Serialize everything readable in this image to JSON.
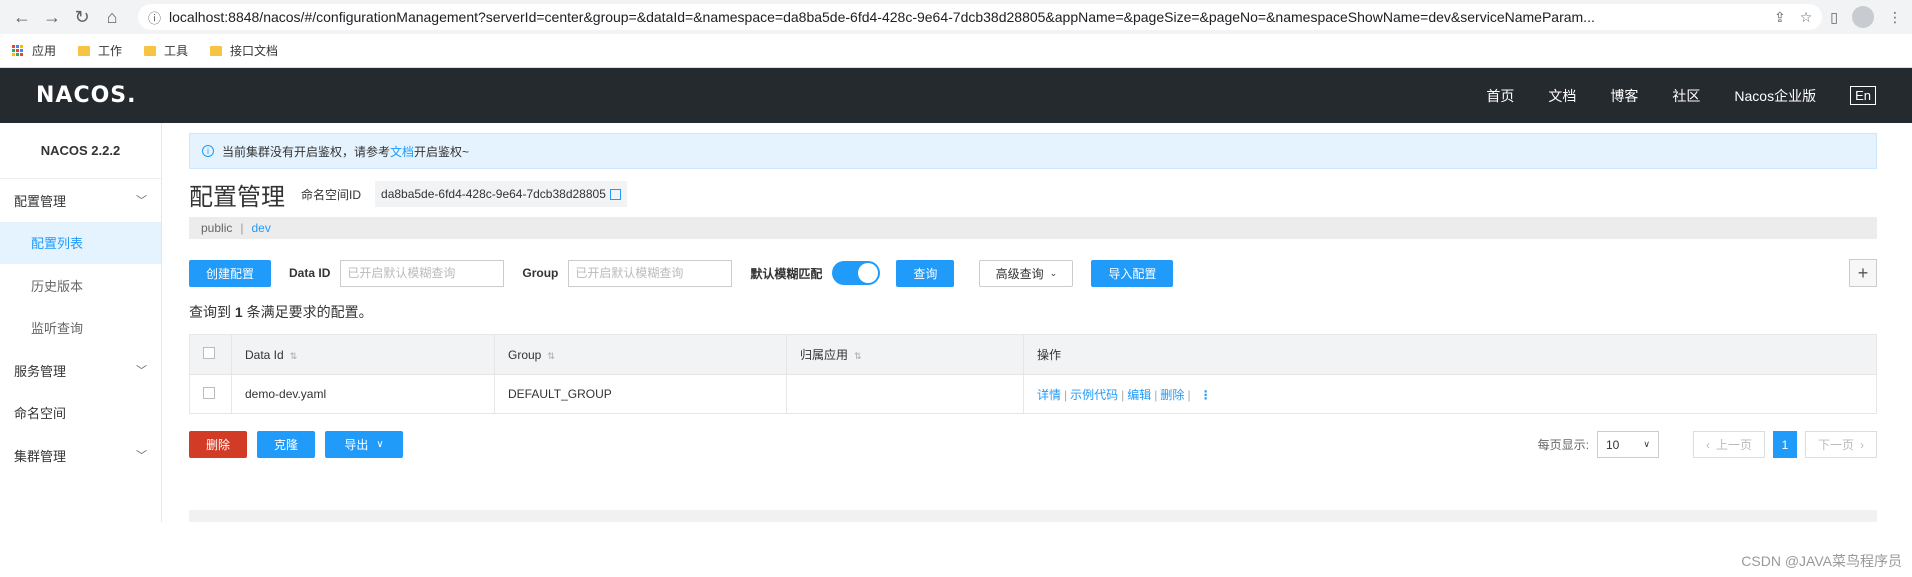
{
  "browser": {
    "url": "localhost:8848/nacos/#/configurationManagement?serverId=center&group=&dataId=&namespace=da8ba5de-6fd4-428c-9e64-7dcb38d28805&appName=&pageSize=&pageNo=&namespaceShowName=dev&serviceNameParam...",
    "bookmarks": [
      "应用",
      "工作",
      "工具",
      "接口文档"
    ]
  },
  "header": {
    "logo": "NACOS.",
    "nav": [
      "首页",
      "文档",
      "博客",
      "社区",
      "Nacos企业版"
    ],
    "lang": "En"
  },
  "sidebar": {
    "version": "NACOS 2.2.2",
    "items": [
      {
        "label": "配置管理",
        "type": "group"
      },
      {
        "label": "配置列表",
        "type": "sub",
        "active": true
      },
      {
        "label": "历史版本",
        "type": "sub"
      },
      {
        "label": "监听查询",
        "type": "sub"
      },
      {
        "label": "服务管理",
        "type": "group"
      },
      {
        "label": "命名空间",
        "type": "plain"
      },
      {
        "label": "集群管理",
        "type": "group"
      }
    ]
  },
  "notice": {
    "before": "当前集群没有开启鉴权，请参考",
    "link": "文档",
    "after": "开启鉴权~"
  },
  "page": {
    "title": "配置管理",
    "namespace_label": "命名空间ID",
    "namespace_id": "da8ba5de-6fd4-428c-9e64-7dcb38d28805",
    "tabs": [
      "public",
      "dev"
    ]
  },
  "toolbar": {
    "create": "创建配置",
    "dataid_label": "Data ID",
    "dataid_placeholder": "已开启默认模糊查询",
    "group_label": "Group",
    "group_placeholder": "已开启默认模糊查询",
    "fuzzy_label": "默认模糊匹配",
    "search": "查询",
    "advanced": "高级查询",
    "import": "导入配置",
    "plus": "+"
  },
  "result": {
    "prefix": "查询到",
    "count": "1",
    "suffix": "条满足要求的配置。"
  },
  "table": {
    "columns": [
      "Data Id",
      "Group",
      "归属应用",
      "操作"
    ],
    "rows": [
      {
        "data_id": "demo-dev.yaml",
        "group": "DEFAULT_GROUP",
        "app": "",
        "ops": [
          "详情",
          "示例代码",
          "编辑",
          "删除"
        ]
      }
    ]
  },
  "footer": {
    "delete": "删除",
    "clone": "克隆",
    "export": "导出",
    "page_size_label": "每页显示:",
    "page_size": "10",
    "prev": "上一页",
    "current": "1",
    "next": "下一页"
  },
  "watermark": "CSDN @JAVA菜鸟程序员",
  "colors": {
    "primary": "#209bfa",
    "danger": "#d23c26",
    "header_bg": "#252a2f"
  }
}
